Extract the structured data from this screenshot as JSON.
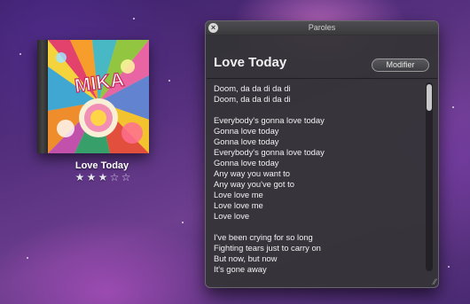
{
  "album": {
    "cover_text": "MIKA",
    "title": "Love Today",
    "rating": {
      "value": 3,
      "max": 5,
      "filled_glyph": "★",
      "empty_glyph": "☆"
    }
  },
  "panel": {
    "window_title": "Paroles",
    "close_glyph": "×",
    "song_title": "Love Today",
    "modify_label": "Modifier",
    "resize_glyph": "⁄⁄",
    "lyrics": [
      "Doom, da da di da di",
      "Doom, da da di da di",
      "",
      "Everybody's gonna love today",
      "Gonna love today",
      "Gonna love today",
      "Everybody's gonna love today",
      "Gonna love today",
      "Any way you want to",
      "Any way you've got to",
      "Love love me",
      "Love love me",
      "Love love",
      "",
      "I've been crying for so long",
      "Fighting tears just to carry on",
      "But now, but now",
      "It's gone away"
    ]
  },
  "colors": {
    "panel_bg": "#343436",
    "text": "#f2f2f2",
    "desktop": "#55307e"
  },
  "icons": {
    "close": "close-icon",
    "rating_filled": "star-filled-icon",
    "rating_empty": "star-empty-icon",
    "resize": "resize-grip-icon"
  }
}
